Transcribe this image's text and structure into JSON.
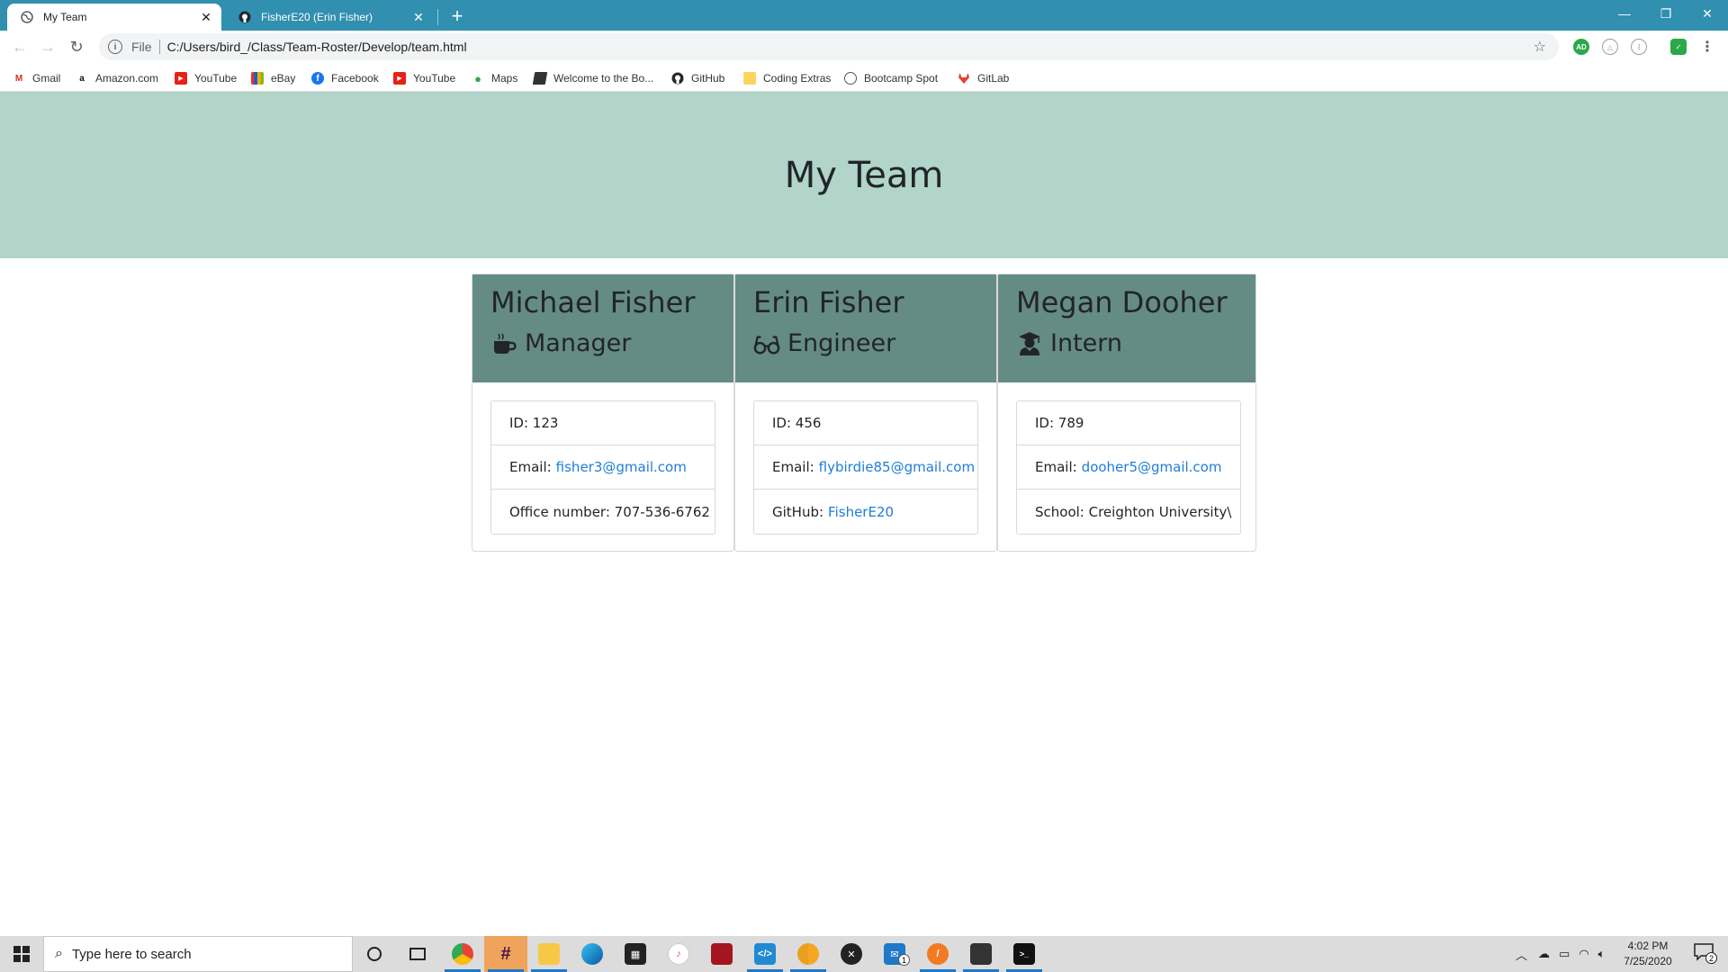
{
  "browser": {
    "tabs": [
      {
        "title": "My Team",
        "icon": "globe-icon",
        "active": true
      },
      {
        "title": "FisherE20 (Erin Fisher)",
        "icon": "github-icon",
        "active": false
      }
    ],
    "address": {
      "scheme_label": "File",
      "url": "C:/Users/bird_/Class/Team-Roster/Develop/team.html"
    },
    "bookmarks": [
      {
        "label": "Gmail",
        "icon": "gmail-icon"
      },
      {
        "label": "Amazon.com",
        "icon": "amazon-icon"
      },
      {
        "label": "YouTube",
        "icon": "youtube-icon"
      },
      {
        "label": "eBay",
        "icon": "ebay-icon"
      },
      {
        "label": "Facebook",
        "icon": "facebook-icon"
      },
      {
        "label": "YouTube",
        "icon": "youtube-icon"
      },
      {
        "label": "Maps",
        "icon": "maps-icon"
      },
      {
        "label": "Welcome to the Bo...",
        "icon": "book-icon"
      },
      {
        "label": "GitHub",
        "icon": "github-icon"
      },
      {
        "label": "Coding Extras",
        "icon": "folder-icon"
      },
      {
        "label": "Bootcamp Spot",
        "icon": "globe-icon"
      },
      {
        "label": "GitLab",
        "icon": "gitlab-icon"
      }
    ],
    "colors": {
      "titlebar": "#318fb0",
      "jumbotron": "#b1d5c8",
      "card_header": "#658c84",
      "link": "#1e7dd6"
    }
  },
  "page": {
    "title": "My Team",
    "team": [
      {
        "name": "Michael Fisher",
        "role": "Manager",
        "role_icon": "coffee-mug-icon",
        "id_label": "ID: 123",
        "email_label": "Email:",
        "email": "fisher3@gmail.com",
        "extra_label": "Office number: 707-536-6762",
        "extra_link": ""
      },
      {
        "name": "Erin Fisher",
        "role": "Engineer",
        "role_icon": "glasses-icon",
        "id_label": "ID: 456",
        "email_label": "Email:",
        "email": "flybirdie85@gmail.com",
        "extra_label": "GitHub:",
        "extra_link": "FisherE20"
      },
      {
        "name": "Megan Dooher",
        "role": "Intern",
        "role_icon": "graduate-icon",
        "id_label": "ID: 789",
        "email_label": "Email:",
        "email": "dooher5@gmail.com",
        "extra_label": "School: Creighton University\\",
        "extra_link": ""
      }
    ]
  },
  "taskbar": {
    "search_placeholder": "Type here to search",
    "time": "4:02 PM",
    "date": "7/25/2020",
    "mail_badge": "1",
    "notification_count": "2"
  }
}
